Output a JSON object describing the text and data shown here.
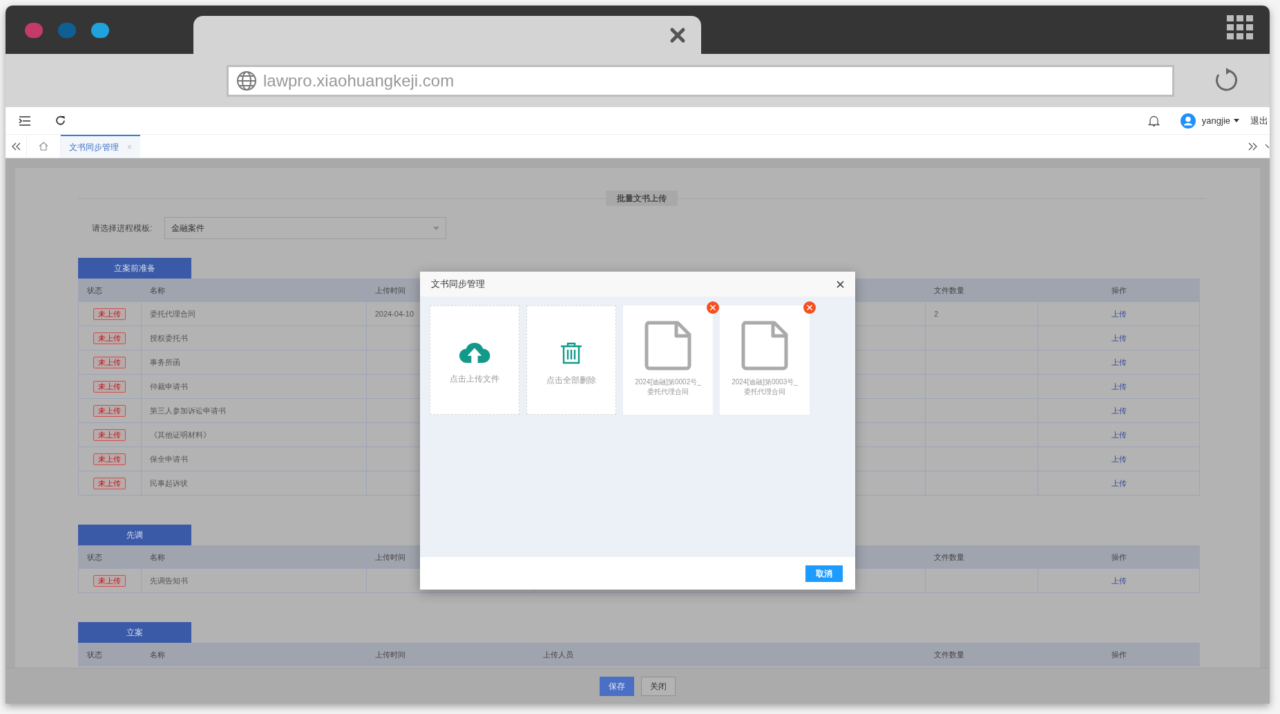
{
  "browser": {
    "url": "lawpro.xiaohuangkeji.com"
  },
  "header": {
    "user": "yangjie",
    "logout": "退出"
  },
  "tabs": [
    {
      "label": "文书同步管理",
      "selected": true
    }
  ],
  "page": {
    "title": "批量文书上传",
    "template_label": "请选择进程模板:",
    "template_value": "金融案件",
    "sections": [
      {
        "title": "立案前准备",
        "columns": {
          "status": "状态",
          "name": "名称",
          "upload_time": "上传时间",
          "file_count": "文件数量",
          "action": "操作"
        },
        "rows": [
          {
            "status": "未上传",
            "name": "委托代理合同",
            "upload_time": "2024-04-10",
            "file_count": "2",
            "action": "上传"
          },
          {
            "status": "未上传",
            "name": "授权委托书",
            "action": "上传"
          },
          {
            "status": "未上传",
            "name": "事务所函",
            "action": "上传"
          },
          {
            "status": "未上传",
            "name": "仲裁申请书",
            "action": "上传"
          },
          {
            "status": "未上传",
            "name": "第三人参加诉讼申请书",
            "action": "上传"
          },
          {
            "status": "未上传",
            "name": "《其他证明材料》",
            "action": "上传"
          },
          {
            "status": "未上传",
            "name": "保全申请书",
            "action": "上传"
          },
          {
            "status": "未上传",
            "name": "民事起诉状",
            "action": "上传"
          }
        ]
      },
      {
        "title": "先调",
        "columns": {
          "status": "状态",
          "name": "名称",
          "upload_time": "上传时间",
          "file_count": "文件数量",
          "action": "操作"
        },
        "rows": [
          {
            "status": "未上传",
            "name": "先调告知书",
            "action": "上传"
          }
        ]
      },
      {
        "title": "立案",
        "columns": {
          "status": "状态",
          "name": "名称",
          "upload_time": "上传时间",
          "uploader": "上传人员",
          "file_count": "文件数量",
          "action": "操作"
        }
      }
    ]
  },
  "footer": {
    "buttons": [
      {
        "kind": "primary",
        "label": "保存"
      },
      {
        "kind": "default",
        "label": "关闭"
      }
    ]
  },
  "modal": {
    "title": "文书同步管理",
    "cards": [
      {
        "kind": "upload",
        "label": "点击上传文件"
      },
      {
        "kind": "delete",
        "label": "点击全部删除"
      },
      {
        "kind": "file",
        "lines": [
          "2024[迪融]第0002号_",
          "委托代理合同"
        ]
      },
      {
        "kind": "file",
        "lines": [
          "2024[迪融]第0003号_",
          "委托代理合同"
        ]
      }
    ],
    "cancel": "取消"
  }
}
